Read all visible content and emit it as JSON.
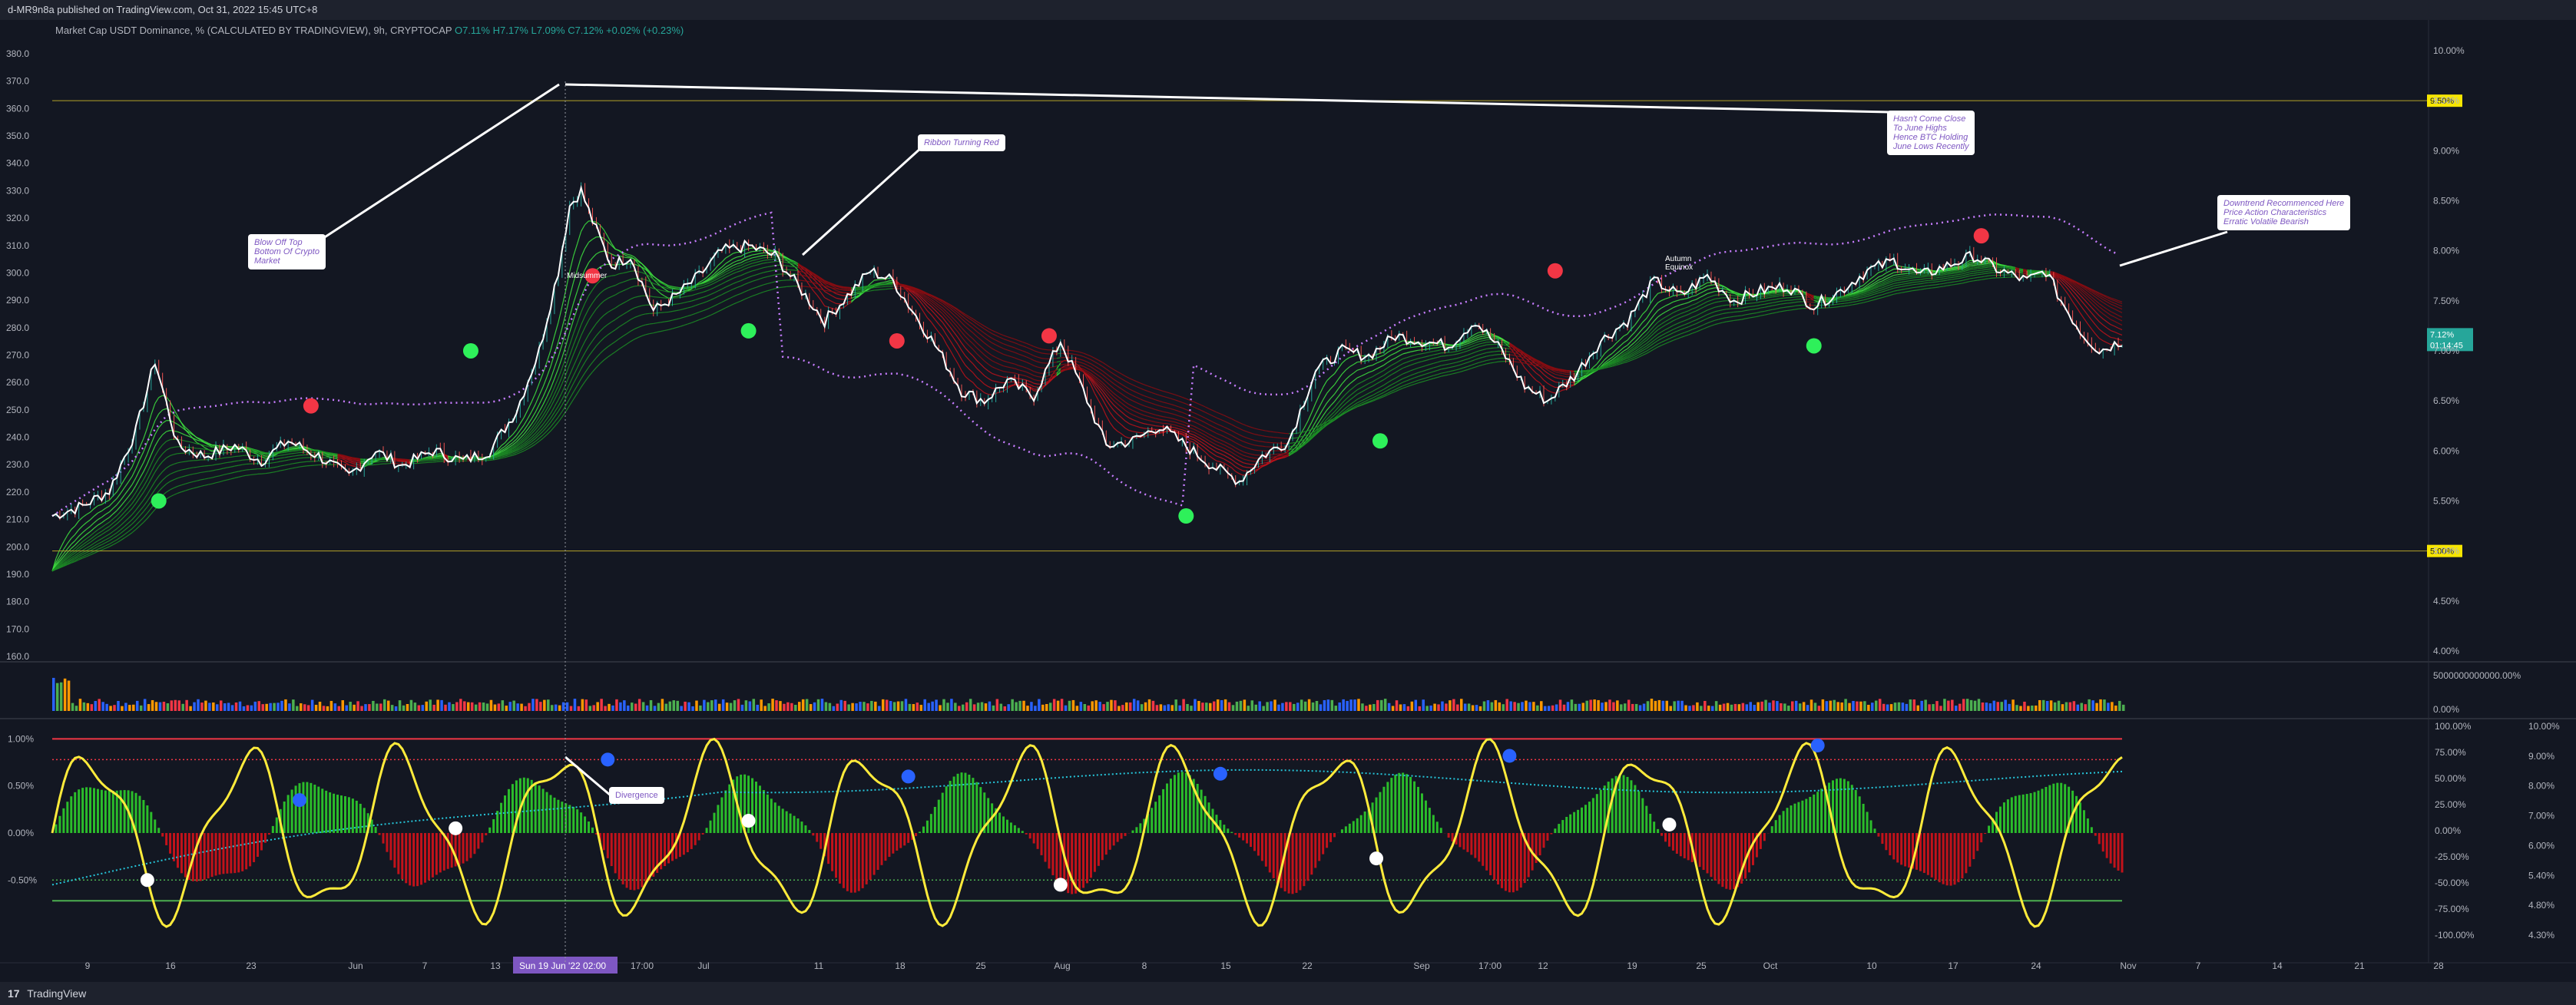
{
  "header": {
    "published": "d-MR9n8a published on TradingView.com, Oct 31, 2022 15:45 UTC+8"
  },
  "legend": {
    "symbol": "Market Cap USDT Dominance, %",
    "source": "(CALCULATED BY TRADINGVIEW), 9h, CRYPTOCAP",
    "o": "O7.11%",
    "h": "H7.17%",
    "l": "L7.09%",
    "c": "C7.12%",
    "change": "+0.02% (+0.23%)"
  },
  "annotations": {
    "blow_off": "Blow Off Top\nBottom Of Crypto\nMarket",
    "ribbon": "Ribbon Turning Red",
    "june_highs": "Hasn't Come Close\nTo June Highs\nHence BTC Holding\nJune Lows Recently",
    "downtrend": "Downtrend Recommenced Here\nPrice Action Characteristics\nErratic Volatile Bearish",
    "divergence": "Divergence",
    "midsummer": "Midsummer",
    "autumn": "Autumn\nEquinox"
  },
  "footer": {
    "brand": "TradingView",
    "logo": "17"
  },
  "chart_data": [
    {
      "type": "line",
      "title": "Market Cap USDT Dominance, %",
      "left_axis_ticks": [
        "380.0",
        "370.0",
        "360.0",
        "350.0",
        "340.0",
        "330.0",
        "320.0",
        "310.0",
        "300.0",
        "290.0",
        "280.0",
        "270.0",
        "260.0",
        "250.0",
        "240.0",
        "230.0",
        "220.0",
        "210.0",
        "200.0",
        "190.0",
        "180.0",
        "170.0",
        "160.0"
      ],
      "right_axis_ticks": [
        "10.00%",
        "9.50%",
        "9.00%",
        "8.50%",
        "8.00%",
        "7.50%",
        "7.00%",
        "6.50%",
        "6.00%",
        "5.50%",
        "5.00%",
        "4.50%",
        "4.00%"
      ],
      "ylim": [
        3.9,
        10.0
      ],
      "horizontal_levels": [
        {
          "label": "9.50%",
          "value": 9.5
        },
        {
          "label": "5.00%",
          "value": 5.0
        }
      ],
      "last_price_label": "7.12%",
      "countdown": "01:14:45",
      "x_labels": [
        "9",
        "16",
        "23",
        "Jun",
        "7",
        "13",
        "Sun 19 Jun '22  02:00",
        "17:00",
        "Jul",
        "11",
        "18",
        "25",
        "Aug",
        "8",
        "15",
        "22",
        "Sep",
        "17:00",
        "12",
        "19",
        "25",
        "Oct",
        "10",
        "17",
        "24",
        "Nov",
        "7",
        "14",
        "21",
        "28"
      ],
      "price_path": [
        [
          0,
          5.35
        ],
        [
          8,
          5.45
        ],
        [
          15,
          5.6
        ],
        [
          22,
          6.2
        ],
        [
          27,
          6.9
        ],
        [
          33,
          6.05
        ],
        [
          40,
          5.95
        ],
        [
          48,
          6.05
        ],
        [
          55,
          5.9
        ],
        [
          62,
          6.1
        ],
        [
          70,
          5.95
        ],
        [
          78,
          5.75
        ],
        [
          85,
          6.0
        ],
        [
          92,
          5.85
        ],
        [
          100,
          6.0
        ],
        [
          108,
          5.9
        ],
        [
          115,
          6.0
        ],
        [
          122,
          6.4
        ],
        [
          128,
          7.0
        ],
        [
          133,
          7.8
        ],
        [
          136,
          8.45
        ],
        [
          139,
          8.6
        ],
        [
          142,
          8.3
        ],
        [
          147,
          7.85
        ],
        [
          152,
          7.95
        ],
        [
          158,
          7.4
        ],
        [
          164,
          7.55
        ],
        [
          170,
          7.75
        ],
        [
          176,
          8.0
        ],
        [
          183,
          8.05
        ],
        [
          190,
          7.95
        ],
        [
          197,
          7.6
        ],
        [
          203,
          7.3
        ],
        [
          209,
          7.55
        ],
        [
          215,
          7.8
        ],
        [
          221,
          7.7
        ],
        [
          227,
          7.35
        ],
        [
          233,
          7.0
        ],
        [
          239,
          6.6
        ],
        [
          245,
          6.5
        ],
        [
          251,
          6.7
        ],
        [
          258,
          6.55
        ],
        [
          265,
          7.1
        ],
        [
          271,
          6.6
        ],
        [
          277,
          6.05
        ],
        [
          284,
          6.1
        ],
        [
          291,
          6.25
        ],
        [
          298,
          6.05
        ],
        [
          305,
          5.85
        ],
        [
          312,
          5.7
        ],
        [
          318,
          5.95
        ],
        [
          325,
          6.1
        ],
        [
          332,
          6.8
        ],
        [
          339,
          7.0
        ],
        [
          346,
          6.95
        ],
        [
          353,
          7.15
        ],
        [
          360,
          7.1
        ],
        [
          367,
          7.05
        ],
        [
          374,
          7.3
        ],
        [
          381,
          7.0
        ],
        [
          387,
          6.65
        ],
        [
          393,
          6.5
        ],
        [
          400,
          6.75
        ],
        [
          407,
          7.1
        ],
        [
          414,
          7.3
        ],
        [
          421,
          7.7
        ],
        [
          428,
          7.55
        ],
        [
          435,
          7.75
        ],
        [
          442,
          7.5
        ],
        [
          449,
          7.6
        ],
        [
          456,
          7.65
        ],
        [
          463,
          7.45
        ],
        [
          470,
          7.6
        ],
        [
          477,
          7.8
        ],
        [
          484,
          7.9
        ],
        [
          491,
          7.75
        ],
        [
          498,
          7.85
        ],
        [
          505,
          7.95
        ],
        [
          512,
          7.8
        ],
        [
          519,
          7.7
        ],
        [
          524,
          7.8
        ],
        [
          528,
          7.5
        ],
        [
          533,
          7.2
        ],
        [
          538,
          7.0
        ],
        [
          544,
          7.1
        ]
      ],
      "bubbles": [
        {
          "i": 28,
          "v": 5.5,
          "c": "green"
        },
        {
          "i": 68,
          "v": 6.45,
          "c": "red"
        },
        {
          "i": 110,
          "v": 7.0,
          "c": "green"
        },
        {
          "i": 142,
          "v": 7.75,
          "c": "red"
        },
        {
          "i": 183,
          "v": 7.2,
          "c": "green"
        },
        {
          "i": 222,
          "v": 7.1,
          "c": "red"
        },
        {
          "i": 262,
          "v": 7.15,
          "c": "red"
        },
        {
          "i": 298,
          "v": 5.35,
          "c": "green"
        },
        {
          "i": 349,
          "v": 6.1,
          "c": "green"
        },
        {
          "i": 395,
          "v": 7.8,
          "c": "red"
        },
        {
          "i": 463,
          "v": 7.05,
          "c": "green"
        },
        {
          "i": 507,
          "v": 8.15,
          "c": "red"
        }
      ]
    },
    {
      "type": "bar",
      "title": "Volume",
      "right_axis_ticks": [
        "5000000000000.00%",
        "0.00%"
      ]
    },
    {
      "type": "line",
      "title": "Oscillator",
      "left_axis_ticks": [
        "1.00%",
        "0.50%",
        "0.00%",
        "-0.50%"
      ],
      "mid_axis_ticks": [
        "100.00%",
        "75.00%",
        "50.00%",
        "25.00%",
        "0.00%",
        "-25.00%",
        "-50.00%",
        "-75.00%",
        "-100.00%"
      ],
      "right_axis_ticks": [
        "10.00%",
        "9.00%",
        "8.00%",
        "7.00%",
        "6.00%",
        "5.40%",
        "4.80%",
        "4.30%"
      ],
      "ylim": [
        -1.15,
        1.15
      ],
      "levels": [
        {
          "value": 1.0,
          "color": "#f23645",
          "style": "solid"
        },
        {
          "value": 0.78,
          "color": "#f23645",
          "style": "dotted"
        },
        {
          "value": -0.5,
          "color": "#4caf50",
          "style": "dotted"
        },
        {
          "value": -0.72,
          "color": "#4caf50",
          "style": "solid"
        }
      ],
      "dots": [
        {
          "i": 25,
          "v": -0.5,
          "c": "white"
        },
        {
          "i": 65,
          "v": 0.35,
          "c": "blue"
        },
        {
          "i": 106,
          "v": 0.05,
          "c": "white"
        },
        {
          "i": 146,
          "v": 0.78,
          "c": "blue"
        },
        {
          "i": 183,
          "v": 0.13,
          "c": "white"
        },
        {
          "i": 225,
          "v": 0.6,
          "c": "blue"
        },
        {
          "i": 265,
          "v": -0.55,
          "c": "white"
        },
        {
          "i": 307,
          "v": 0.63,
          "c": "blue"
        },
        {
          "i": 348,
          "v": -0.27,
          "c": "white"
        },
        {
          "i": 383,
          "v": 0.82,
          "c": "blue"
        },
        {
          "i": 425,
          "v": 0.09,
          "c": "white"
        },
        {
          "i": 464,
          "v": 0.93,
          "c": "blue"
        }
      ]
    }
  ]
}
